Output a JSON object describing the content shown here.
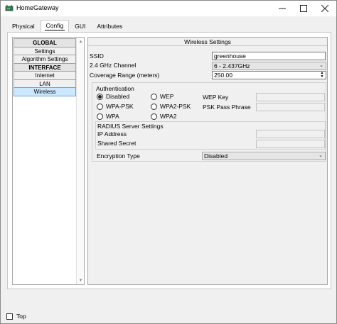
{
  "window": {
    "title": "HomeGateway"
  },
  "tabs": [
    {
      "label": "Physical"
    },
    {
      "label": "Config"
    },
    {
      "label": "GUI"
    },
    {
      "label": "Attributes"
    }
  ],
  "nav": {
    "items": [
      {
        "label": "GLOBAL"
      },
      {
        "label": "Settings"
      },
      {
        "label": "Algorithm Settings"
      },
      {
        "label": "INTERFACE"
      },
      {
        "label": "Internet"
      },
      {
        "label": "LAN"
      },
      {
        "label": "Wireless"
      }
    ]
  },
  "wireless": {
    "title": "Wireless Settings",
    "ssid_label": "SSID",
    "ssid_value": "greenhouse",
    "channel_label": "2.4 GHz Channel",
    "channel_value": "6 - 2.437GHz",
    "coverage_label": "Coverage Range (meters)",
    "coverage_value": "250.00",
    "auth": {
      "title": "Authentication",
      "disabled": "Disabled",
      "wep": "WEP",
      "wpa_psk": "WPA-PSK",
      "wpa2_psk": "WPA2-PSK",
      "wpa": "WPA",
      "wpa2": "WPA2",
      "wep_key_label": "WEP Key",
      "psk_label": "PSK Pass Phrase"
    },
    "radius": {
      "title": "RADIUS Server Settings",
      "ip_label": "IP Address",
      "secret_label": "Shared Secret"
    },
    "encryption_label": "Encryption Type",
    "encryption_value": "Disabled"
  },
  "footer": {
    "top_label": "Top"
  }
}
